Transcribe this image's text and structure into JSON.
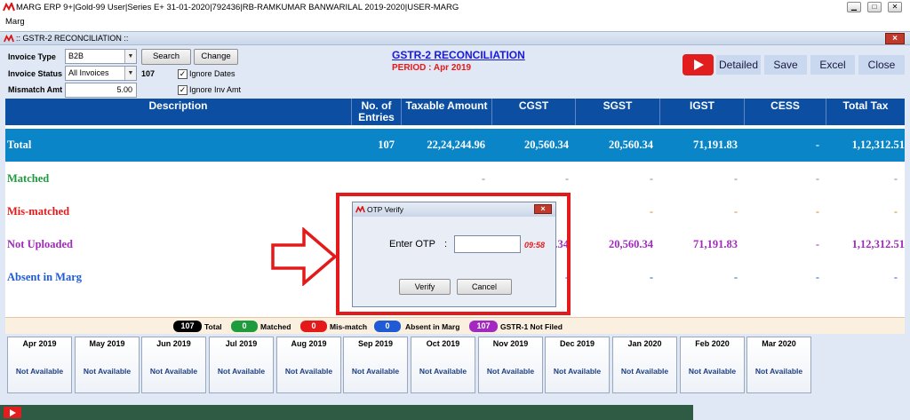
{
  "window": {
    "title": "MARG ERP 9+|Gold-99 User|Series E+ 31-01-2020|792436|RB-RAMKUMAR BANWARILAL 2019-2020|USER-MARG",
    "menu": "Marg",
    "inner_title": ":: GSTR-2 RECONCILIATION ::",
    "inner_close": "×"
  },
  "filters": {
    "invoice_type_label": "Invoice Type",
    "invoice_type_value": "B2B",
    "invoice_status_label": "Invoice Status",
    "invoice_status_value": "All Invoices",
    "count": "107",
    "mismatch_label": "Mismatch Amt",
    "mismatch_value": "5.00",
    "search_label": "Search",
    "change_label": "Change",
    "ignore_dates_label": "Ignore Dates",
    "ignore_inv_amt_label": "Ignore Inv Amt"
  },
  "heading": {
    "title": "GSTR-2 RECONCILIATION",
    "period": "PERIOD : Apr 2019"
  },
  "toolbar": {
    "detailed": "Detailed",
    "save": "Save",
    "excel": "Excel",
    "close": "Close"
  },
  "table": {
    "headers": [
      "Description",
      "No. of Entries",
      "Taxable Amount",
      "CGST",
      "SGST",
      "IGST",
      "CESS",
      "Total Tax"
    ],
    "rows": [
      {
        "desc": "Total",
        "entries": "107",
        "taxable": "22,24,244.96",
        "cgst": "20,560.34",
        "sgst": "20,560.34",
        "igst": "71,191.83",
        "cess": "-",
        "total": "1,12,312.51"
      },
      {
        "desc": "Matched",
        "entries": "",
        "taxable": "-",
        "cgst": "-",
        "sgst": "-",
        "igst": "-",
        "cess": "-",
        "total": "-"
      },
      {
        "desc": "Mis-matched",
        "entries": "",
        "taxable": "",
        "cgst": "",
        "sgst": "-",
        "igst": "-",
        "cess": "-",
        "total": "-"
      },
      {
        "desc": "Not Uploaded",
        "entries": "",
        "taxable": "",
        "cgst": "0.34",
        "sgst": "20,560.34",
        "igst": "71,191.83",
        "cess": "-",
        "total": "1,12,312.51"
      },
      {
        "desc": "Absent in Marg",
        "entries": "",
        "taxable": "",
        "cgst": "-",
        "sgst": "-",
        "igst": "-",
        "cess": "-",
        "total": "-"
      }
    ]
  },
  "legend": [
    {
      "count": "107",
      "label": "Total",
      "color": "#000000"
    },
    {
      "count": "0",
      "label": "Matched",
      "color": "#1e9b3c"
    },
    {
      "count": "0",
      "label": "Mis-match",
      "color": "#e41a1a"
    },
    {
      "count": "0",
      "label": "Absent in Marg",
      "color": "#1f5bd6"
    },
    {
      "count": "107",
      "label": "GSTR-1 Not Filed",
      "color": "#a228c0"
    }
  ],
  "months": [
    {
      "name": "Apr 2019",
      "status": "Not Available"
    },
    {
      "name": "May 2019",
      "status": "Not Available"
    },
    {
      "name": "Jun 2019",
      "status": "Not Available"
    },
    {
      "name": "Jul 2019",
      "status": "Not Available"
    },
    {
      "name": "Aug 2019",
      "status": "Not Available"
    },
    {
      "name": "Sep 2019",
      "status": "Not Available"
    },
    {
      "name": "Oct 2019",
      "status": "Not Available"
    },
    {
      "name": "Nov 2019",
      "status": "Not Available"
    },
    {
      "name": "Dec 2019",
      "status": "Not Available"
    },
    {
      "name": "Jan 2020",
      "status": "Not Available"
    },
    {
      "name": "Feb 2020",
      "status": "Not Available"
    },
    {
      "name": "Mar 2020",
      "status": "Not Available"
    }
  ],
  "otp_dialog": {
    "title": "OTP Verify",
    "label": "Enter OTP",
    "colon": ":",
    "value": "",
    "timer": "09:58",
    "verify": "Verify",
    "cancel": "Cancel",
    "close": "×"
  },
  "colors": {
    "header_blue": "#0b4ea2",
    "total_row": "#0a86c8",
    "matched": "#1e9b3c",
    "mismatched": "#e41a1a",
    "not_uploaded": "#a228c0",
    "absent": "#1f5bd6",
    "highlight": "#e41a1a"
  }
}
